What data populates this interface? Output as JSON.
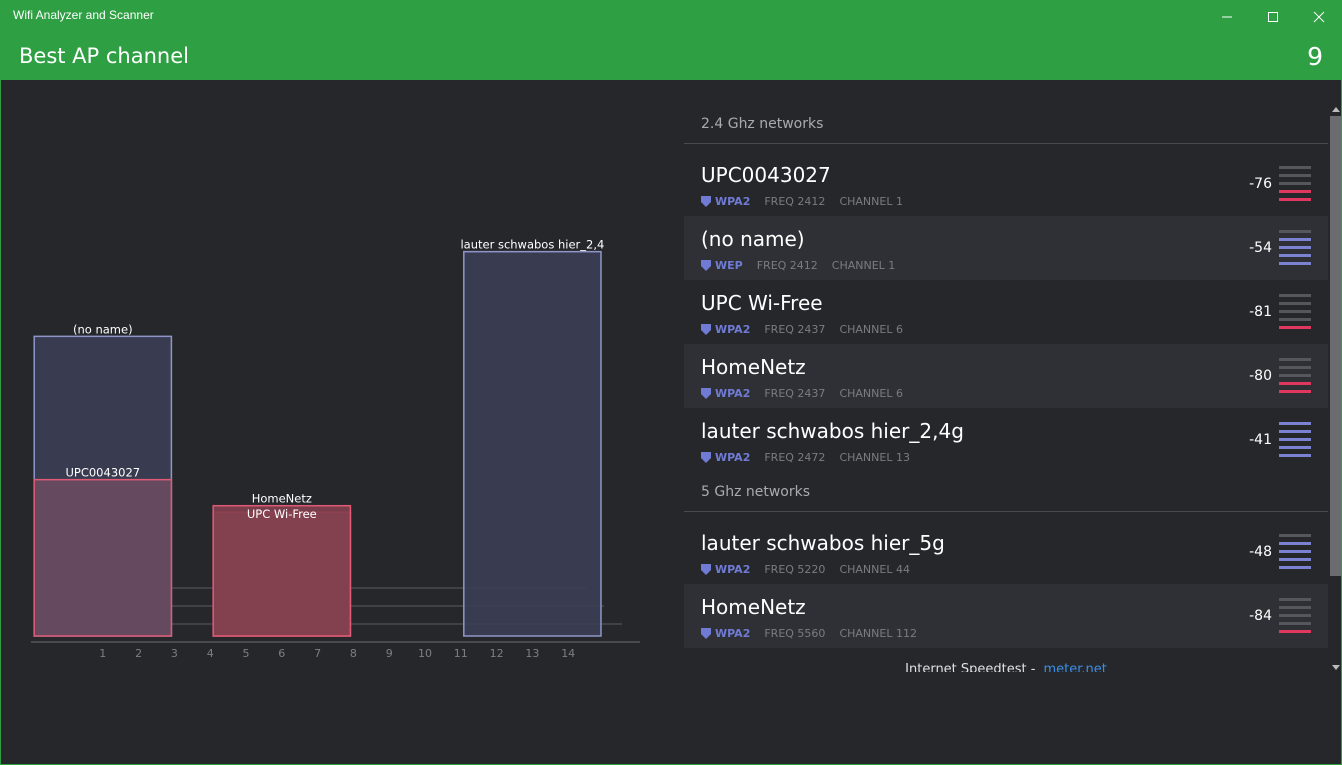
{
  "window": {
    "title": "Wifi Analyzer and Scanner"
  },
  "header": {
    "heading": "Best AP channel",
    "best_channel": "9"
  },
  "chart_data": {
    "type": "bar",
    "x_ticks": [
      "1",
      "2",
      "3",
      "4",
      "5",
      "6",
      "7",
      "8",
      "9",
      "10",
      "11",
      "12",
      "13",
      "14"
    ],
    "xlim": [
      0,
      15
    ],
    "ylim": [
      -100,
      -30
    ],
    "bars": [
      {
        "name": "(no name)",
        "channel": 1,
        "x_start": -1,
        "x_end": 3,
        "level": -54,
        "color": "#8f96c7",
        "fill": "#3c3f55"
      },
      {
        "name": "UPC0043027",
        "channel": 1,
        "x_start": -1,
        "x_end": 3,
        "level": -76,
        "color": "#e05a75",
        "fill": "#6a4a60"
      },
      {
        "name": "UPC Wi-Free",
        "channel": 6,
        "x_start": 4,
        "x_end": 8,
        "level": -81,
        "color": "#e05a75",
        "fill": "#84404f"
      },
      {
        "name": "HomeNetz",
        "channel": 6,
        "x_start": 4,
        "x_end": 8,
        "level": -80,
        "color": "#e05a75",
        "fill": "#84404f"
      },
      {
        "name": "lauter schwabos hier_2,4",
        "channel": 13,
        "x_start": 11,
        "x_end": 15,
        "level": -41,
        "color": "#8f96c7",
        "fill": "#3c3f55"
      }
    ]
  },
  "sections": [
    {
      "label": "2.4 Ghz networks"
    },
    {
      "label": "5 Ghz networks"
    }
  ],
  "networks": [
    {
      "ssid": "UPC0043027",
      "security": "WPA2",
      "freq": "FREQ 2412",
      "channel": "CHANNEL 1",
      "rssi": "-76",
      "strength": 2,
      "color": "#e0365f"
    },
    {
      "ssid": "(no name)",
      "security": "WEP",
      "freq": "FREQ 2412",
      "channel": "CHANNEL 1",
      "rssi": "-54",
      "strength": 4,
      "color": "#7b82d1"
    },
    {
      "ssid": "UPC Wi-Free",
      "security": "WPA2",
      "freq": "FREQ 2437",
      "channel": "CHANNEL 6",
      "rssi": "-81",
      "strength": 1,
      "color": "#e0365f"
    },
    {
      "ssid": "HomeNetz",
      "security": "WPA2",
      "freq": "FREQ 2437",
      "channel": "CHANNEL 6",
      "rssi": "-80",
      "strength": 2,
      "color": "#e0365f"
    },
    {
      "ssid": "lauter schwabos hier_2,4g",
      "security": "WPA2",
      "freq": "FREQ 2472",
      "channel": "CHANNEL 13",
      "rssi": "-41",
      "strength": 5,
      "color": "#7b82d1"
    },
    {
      "ssid": "lauter schwabos hier_5g",
      "security": "WPA2",
      "freq": "FREQ 5220",
      "channel": "CHANNEL 44",
      "rssi": "-48",
      "strength": 4,
      "color": "#7b82d1"
    },
    {
      "ssid": "HomeNetz",
      "security": "WPA2",
      "freq": "FREQ 5560",
      "channel": "CHANNEL 112",
      "rssi": "-84",
      "strength": 1,
      "color": "#e0365f"
    }
  ],
  "footer": {
    "text": "Internet Speedtest -",
    "link": "meter.net"
  },
  "colors": {
    "accent": "#2ea043",
    "bar_off": "#56575c"
  }
}
